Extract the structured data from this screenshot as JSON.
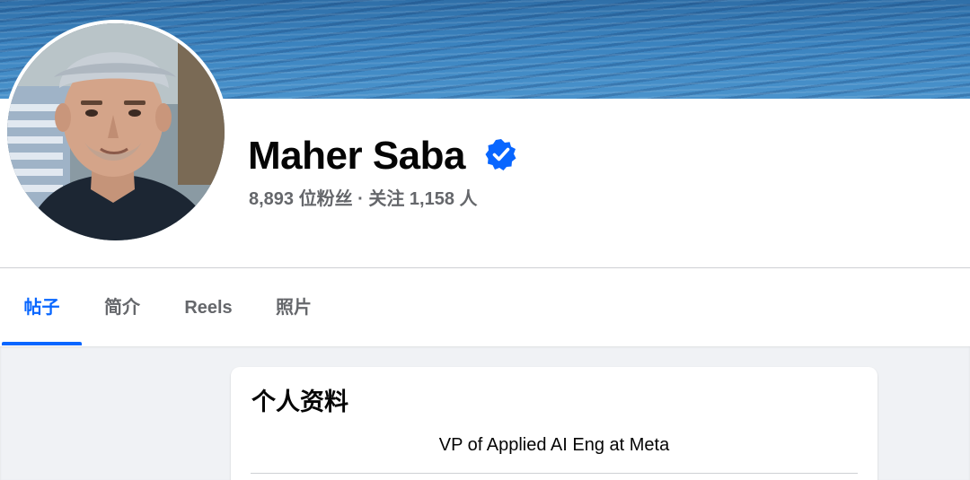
{
  "profile": {
    "name": "Maher Saba",
    "verified": true,
    "stats": "8,893 位粉丝 · 关注 1,158 人"
  },
  "tabs": [
    {
      "label": "帖子",
      "active": true
    },
    {
      "label": "简介",
      "active": false
    },
    {
      "label": "Reels",
      "active": false
    },
    {
      "label": "照片",
      "active": false
    }
  ],
  "intro": {
    "title": "个人资料",
    "bio": "VP of Applied AI Eng at Meta"
  },
  "colors": {
    "accent": "#0866ff",
    "secondary_text": "#65676b",
    "primary_text": "#050505",
    "feed_background": "#f0f2f5",
    "verified_badge": "#0866ff"
  },
  "icons": {
    "verified": "verified-badge-icon"
  }
}
